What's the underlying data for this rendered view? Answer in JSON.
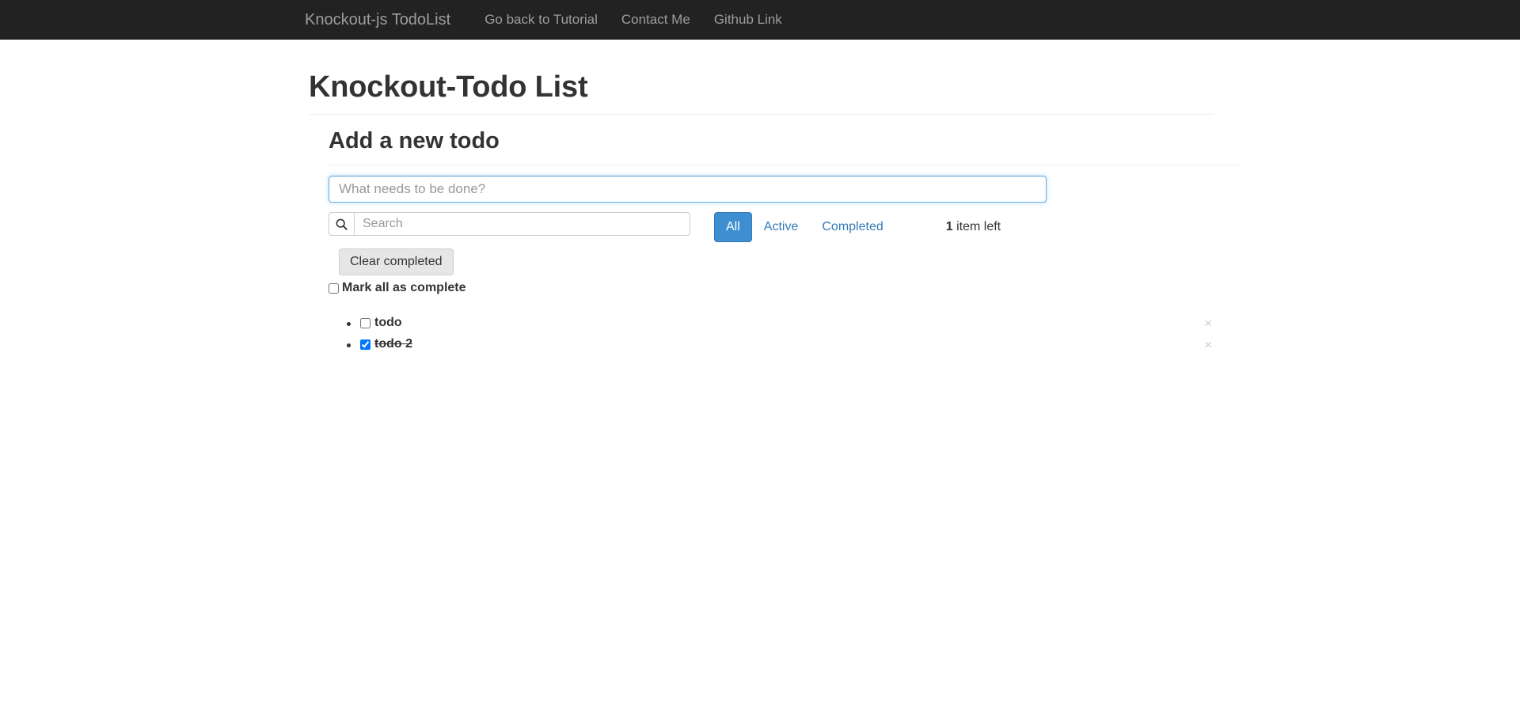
{
  "navbar": {
    "brand": "Knockout-js TodoList",
    "links": [
      {
        "label": "Go back to Tutorial",
        "name": "nav-link-tutorial"
      },
      {
        "label": "Contact Me",
        "name": "nav-link-contact"
      },
      {
        "label": "Github Link",
        "name": "nav-link-github"
      }
    ]
  },
  "page": {
    "title": "Knockout-Todo List",
    "section_title": "Add a new todo"
  },
  "new_todo": {
    "placeholder": "What needs to be done?",
    "value": ""
  },
  "search": {
    "placeholder": "Search",
    "value": "",
    "icon": "search-icon"
  },
  "filters": {
    "all": "All",
    "active": "Active",
    "completed": "Completed",
    "selected": "All"
  },
  "status": {
    "count": "1",
    "suffix": " item left"
  },
  "actions": {
    "clear_completed": "Clear completed",
    "mark_all": "Mark all as complete",
    "mark_all_checked": false,
    "delete_icon": "×"
  },
  "todos": [
    {
      "label": "todo",
      "completed": false
    },
    {
      "label": "todo 2",
      "completed": true
    }
  ],
  "colors": {
    "navbar_bg": "#222222",
    "navbar_text": "#9d9d9d",
    "primary": "#3d8fd1",
    "link": "#337ab7",
    "focus_border": "#66afe9",
    "text": "#333333",
    "muted": "#999999",
    "delete": "#cccccc"
  }
}
